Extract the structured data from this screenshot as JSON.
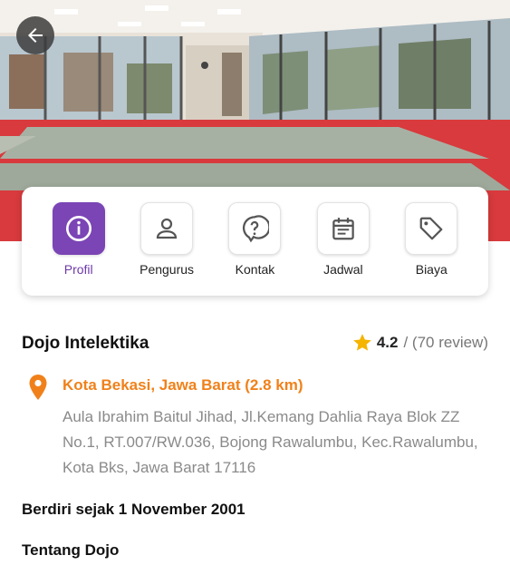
{
  "header": {
    "back_icon": "arrow-left-icon",
    "photo_alt": "dojo-interior-photo"
  },
  "menu": {
    "items": [
      {
        "label": "Profil",
        "icon": "info-icon",
        "active": true
      },
      {
        "label": "Pengurus",
        "icon": "person-icon",
        "active": false
      },
      {
        "label": "Kontak",
        "icon": "question-bubble-icon",
        "active": false
      },
      {
        "label": "Jadwal",
        "icon": "calendar-icon",
        "active": false
      },
      {
        "label": "Biaya",
        "icon": "tag-icon",
        "active": false
      }
    ]
  },
  "dojo": {
    "name": "Dojo Intelektika",
    "rating": "4.2",
    "reviews": "/ (70 review)",
    "location": "Kota Bekasi, Jawa Barat (2.8 km)",
    "address": "Aula Ibrahim Baitul Jihad, Jl.Kemang Dahlia Raya Blok ZZ No.1, RT.007/RW.036, Bojong Rawalumbu, Kec.Rawalumbu, Kota Bks, Jawa Barat 17116",
    "founded": "Berdiri sejak 1 November 2001",
    "about_heading": "Tentang Dojo"
  },
  "colors": {
    "accent_purple": "#7b45b5",
    "location_orange": "#f0811a",
    "star_yellow": "#f5b400"
  }
}
